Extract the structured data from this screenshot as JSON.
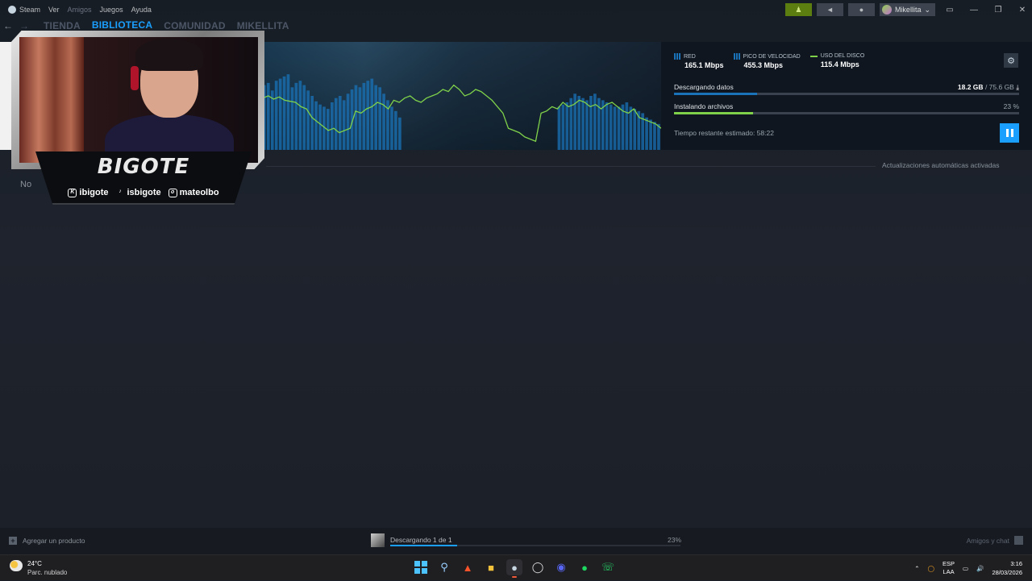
{
  "menubar": {
    "items": [
      {
        "label": "Steam"
      },
      {
        "label": "Ver"
      },
      {
        "label": "Amigos"
      },
      {
        "label": "Juegos"
      },
      {
        "label": "Ayuda"
      }
    ],
    "username": "Mikellita"
  },
  "nav": {
    "tabs": [
      {
        "label": "TIENDA",
        "active": false
      },
      {
        "label": "BIBLIOTECA",
        "active": true
      },
      {
        "label": "COMUNIDAD",
        "active": false
      },
      {
        "label": "MIKELLITA",
        "active": false
      }
    ]
  },
  "downloads": {
    "stats": [
      {
        "label": "RED",
        "value": "165.1 Mbps",
        "icon": "bars-icon"
      },
      {
        "label": "PICO DE VELOCIDAD",
        "value": "455.3 Mbps",
        "icon": "bars-icon"
      },
      {
        "label": "USO DEL DISCO",
        "value": "115.4 Mbps",
        "icon": "line-icon"
      }
    ],
    "downloading_label": "Descargando datos",
    "downloaded": "18.2 GB",
    "total": "/ 75.6 GB",
    "download_progress": 0.24,
    "installing_label": "Instalando archivos",
    "install_percent": "23 %",
    "install_progress": 0.23,
    "time_left": "Tiempo restante estimado: 58:22",
    "auto_updates": "Actualizaciones automáticas activadas",
    "no_text": "No",
    "colors": {
      "accent": "#1a9fff",
      "disk": "#7fd14a",
      "network": "#1a73b8"
    },
    "graph": {
      "network": [
        60,
        62,
        55,
        64,
        66,
        68,
        70,
        58,
        62,
        64,
        60,
        55,
        50,
        45,
        42,
        40,
        38,
        44,
        48,
        50,
        46,
        52,
        56,
        60,
        58,
        62,
        64,
        66,
        60,
        58,
        52,
        46,
        40,
        36,
        30,
        0,
        0,
        0,
        0,
        0,
        0,
        0,
        0,
        0,
        0,
        0,
        0,
        0,
        0,
        0,
        0,
        0,
        0,
        0,
        0,
        0,
        0,
        0,
        0,
        0,
        0,
        0,
        0,
        0,
        0,
        0,
        0,
        0,
        0,
        0,
        0,
        0,
        0,
        0,
        40,
        42,
        44,
        48,
        52,
        50,
        48,
        46,
        50,
        52,
        48,
        46,
        44,
        42,
        40,
        40,
        42,
        44,
        40,
        38,
        36,
        34,
        30,
        28,
        26,
        24
      ],
      "disk": [
        48,
        50,
        47,
        49,
        46,
        45,
        44,
        40,
        38,
        30,
        26,
        22,
        18,
        20,
        16,
        18,
        20,
        36,
        34,
        38,
        40,
        44,
        42,
        38,
        46,
        44,
        48,
        50,
        46,
        44,
        48,
        50,
        52,
        56,
        54,
        60,
        56,
        50,
        52,
        56,
        54,
        50,
        46,
        40,
        34,
        20,
        18,
        16,
        12,
        10,
        8,
        34,
        36,
        40,
        38,
        44,
        40,
        42,
        46,
        44,
        40,
        42,
        38,
        42,
        44,
        40,
        36,
        34,
        38,
        30,
        28,
        26,
        24,
        20
      ]
    }
  },
  "webcam": {
    "name": "BIGOTE",
    "socials": [
      {
        "icon": "twitch-kick-icon",
        "handle": "ibigote"
      },
      {
        "icon": "tiktok-icon",
        "handle": "isbigote"
      },
      {
        "icon": "instagram-icon",
        "handle": "mateolbo"
      }
    ]
  },
  "bottom": {
    "add_product": "Agregar un producto",
    "download_status": "Descargando 1 de 1",
    "download_percent": "23%",
    "download_progress": 0.23,
    "friends_chat": "Amigos y chat"
  },
  "taskbar": {
    "temperature": "24°C",
    "weather": "Parc. nublado",
    "lang_top": "ESP",
    "lang_bottom": "LAA",
    "time": "3:16",
    "date": "28/03/2026"
  }
}
